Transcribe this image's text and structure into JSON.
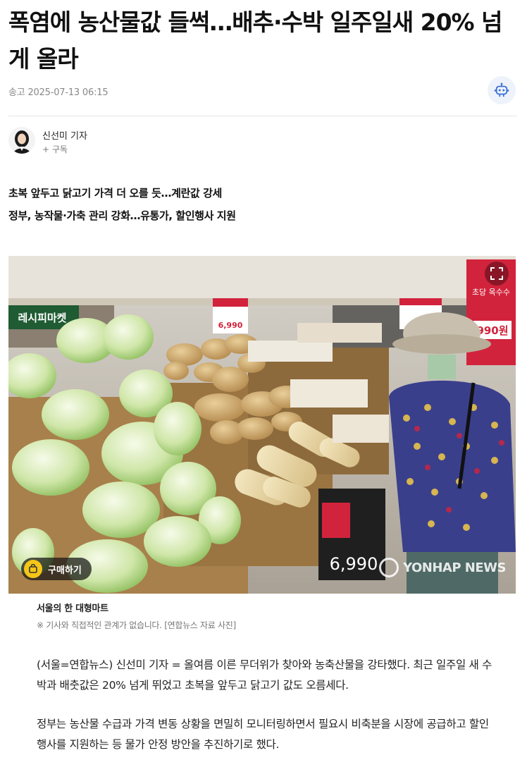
{
  "article": {
    "headline": "폭염에 농산물값 들썩…배추·수박 일주일새 20% 넘게 올라",
    "sent_date": "송고 2025-07-13 06:15",
    "ai_button_icon": "robot-icon",
    "reporter": {
      "name": "신선미 기자",
      "subscribe_label": "+ 구독"
    },
    "summary": [
      "초복 앞두고 닭고기 가격 더 오를 듯…계란값 강세",
      "정부, 농작물·가축 관리 강화…유통가, 할인행사 지원"
    ],
    "photo": {
      "buy_label": "구매하기",
      "watermark": "YONHAP NEWS",
      "price_tag_1": "6,990",
      "price_tag_2": "990원",
      "sign_text": "초당 옥수수",
      "banner_text": "레시피마켓",
      "caption": "서울의 한 대형마트",
      "caption_note": "※ 기사와 직접적인 관계가 없습니다. [연합뉴스 자료 사진]"
    },
    "paragraphs": [
      "(서울=연합뉴스) 신선미 기자 = 올여름 이른 무더위가 찾아와 농축산물을 강타했다. 최근 일주일 새 수박과 배춧값은 20% 넘게 뛰었고 초복을 앞두고 닭고기 값도 오름세다.",
      "정부는 농산물 수급과 가격 변동 상황을 면밀히 모니터링하면서 필요시 비축분을 시장에 공급하고 할인 행사를 지원하는 등 물가 안정 방안을 추진하기로 했다."
    ]
  },
  "colors": {
    "accent": "#3b6fd6",
    "cabbage": "#c9e3a3",
    "radish": "#e8d9a8",
    "price_red": "#d2233c"
  }
}
